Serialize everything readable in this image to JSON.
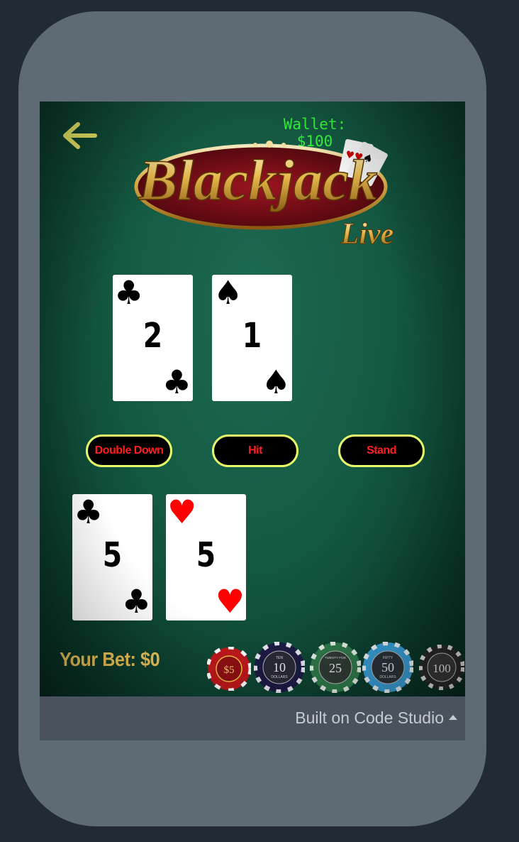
{
  "wallet": {
    "text": "Wallet: $100"
  },
  "logo": {
    "title": "Blackjack",
    "subtitle": "Live"
  },
  "dealer_cards": [
    {
      "rank": "2",
      "suit": "♣",
      "color": "black"
    },
    {
      "rank": "1",
      "suit": "♠",
      "color": "black"
    }
  ],
  "actions": {
    "double_down": "Double Down",
    "hit": "Hit",
    "stand": "Stand"
  },
  "player_cards": [
    {
      "rank": "5",
      "suit": "♣",
      "color": "black"
    },
    {
      "rank": "5",
      "suit": "♥",
      "color": "red"
    }
  ],
  "bet": {
    "label": "Your Bet: $0"
  },
  "chips": [
    {
      "value": "$5",
      "sub": "",
      "color": "#c0181b"
    },
    {
      "value": "10",
      "sub": "DOLLARS",
      "top": "TEN",
      "color": "#1d1a45"
    },
    {
      "value": "25",
      "sub": "",
      "top": "TWENTY FIVE",
      "color": "#2f7a4a"
    },
    {
      "value": "50",
      "sub": "DOLLARS",
      "top": "FIFTY",
      "color": "#3aa0d8"
    },
    {
      "value": "100",
      "sub": "",
      "color": "#2a2a2a"
    }
  ],
  "footer": {
    "text": "Built on Code Studio"
  },
  "colors": {
    "wallet": "#37ff3f",
    "button_border": "#e8ff6b",
    "button_text": "#ff1e1e",
    "bet_label": "#f2c85a"
  }
}
